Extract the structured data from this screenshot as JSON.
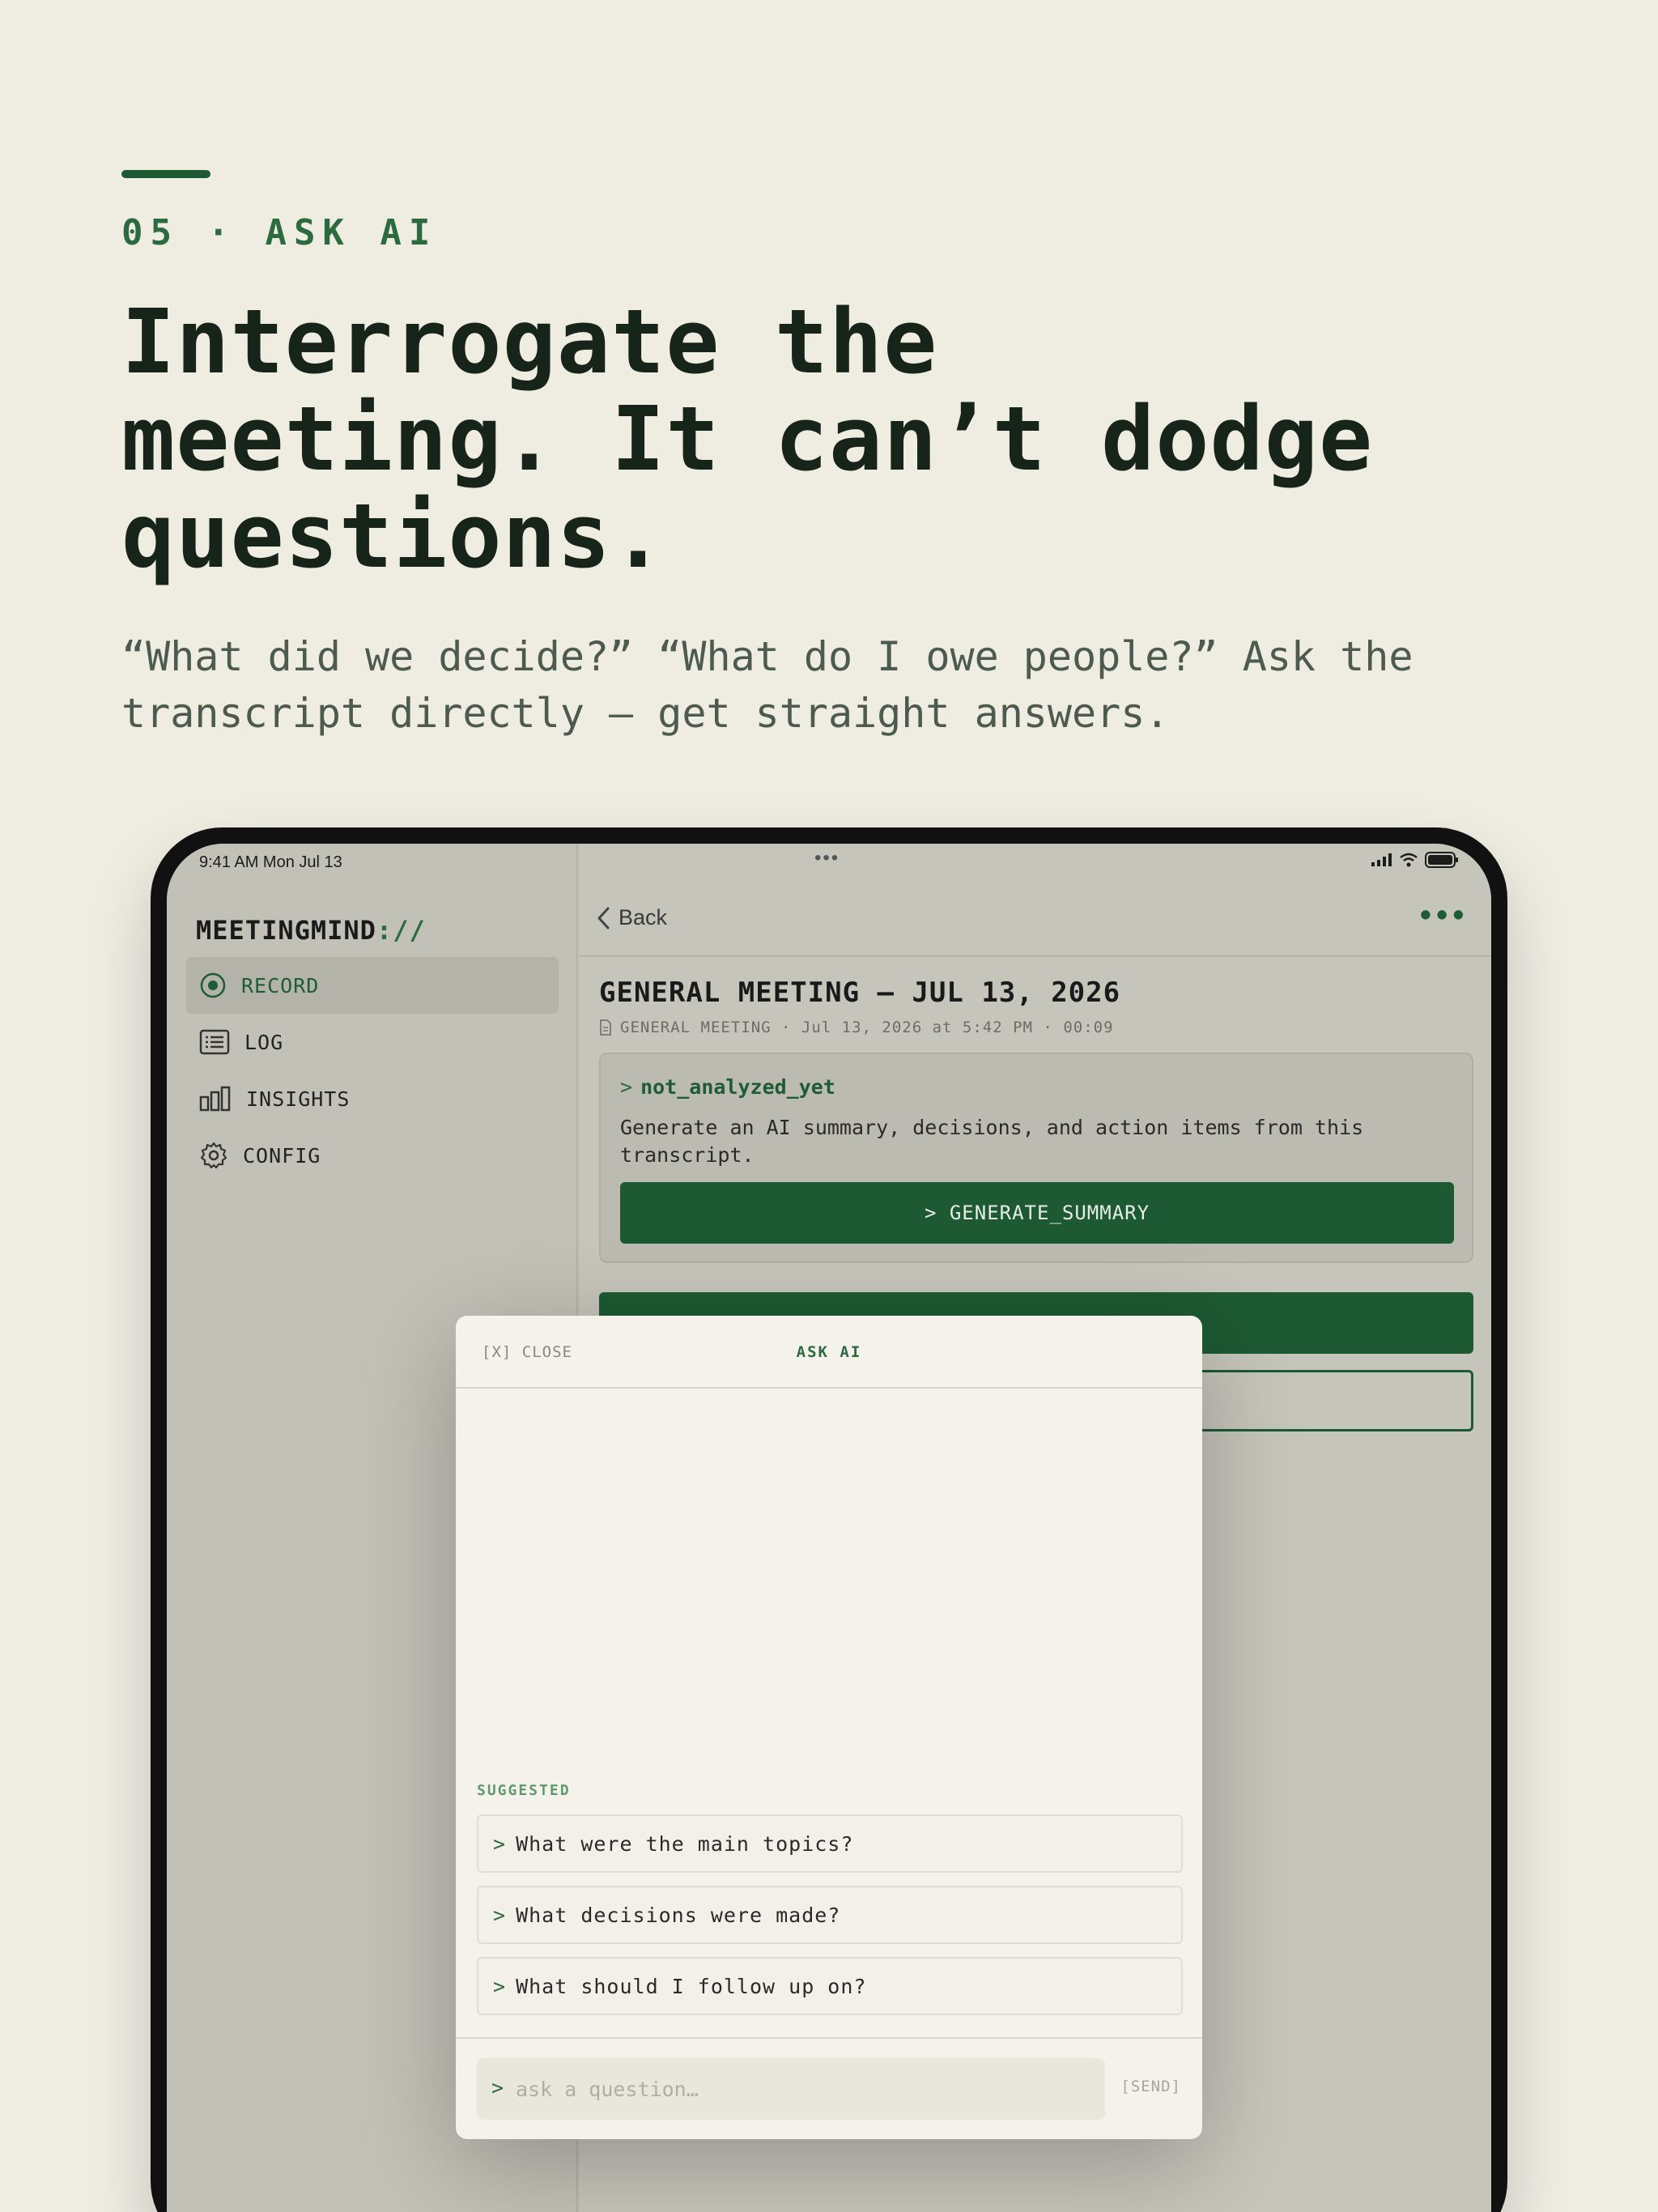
{
  "hero": {
    "eyebrow": "05 · ASK AI",
    "headline": "Interrogate the meeting. It can’t dodge questions.",
    "subhead": "“What did we decide?” “What do I owe people?” Ask the transcript directly — get straight answers."
  },
  "status_bar": {
    "time": "9:41 AM  Mon Jul 13",
    "dots": "•••"
  },
  "sidebar": {
    "logo": "MEETINGMIND",
    "logo_suffix": "://",
    "items": [
      {
        "label": "RECORD",
        "icon": "record-icon",
        "active": true
      },
      {
        "label": "LOG",
        "icon": "list-icon",
        "active": false
      },
      {
        "label": "INSIGHTS",
        "icon": "bar-chart-icon",
        "active": false
      },
      {
        "label": "CONFIG",
        "icon": "gear-icon",
        "active": false
      }
    ]
  },
  "detail": {
    "back_label": "Back",
    "more_label": "•••",
    "title": "GENERAL MEETING — JUL 13, 2026",
    "meta": "GENERAL MEETING · Jul 13, 2026 at 5:42 PM · 00:09",
    "card": {
      "label_prefix": ">",
      "label": "not_analyzed_yet",
      "body": "Generate an AI summary, decisions, and action items from this transcript.",
      "button": "> GENERATE_SUMMARY"
    }
  },
  "modal": {
    "close_label": "[X] CLOSE",
    "title": "ASK AI",
    "suggested_label": "SUGGESTED",
    "suggestions": [
      "What were the main topics?",
      "What decisions were made?",
      "What should I follow up on?"
    ],
    "input_prompt": ">",
    "input_placeholder": "ask a question…",
    "send_label": "[SEND]"
  },
  "colors": {
    "accent": "#1d5a33",
    "background": "#efece2"
  }
}
